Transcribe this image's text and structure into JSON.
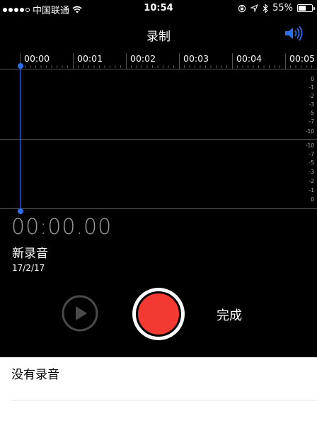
{
  "status_bar": {
    "carrier": "中国联通",
    "time": "10:54",
    "battery": "55%",
    "battery_level": 0.55,
    "icons": [
      "signal-dots-icon",
      "wifi-icon",
      "rotation-lock-icon",
      "location-icon",
      "bluetooth-icon",
      "battery-icon"
    ]
  },
  "nav": {
    "title": "录制",
    "speaker_icon": "speaker-icon"
  },
  "timeline": {
    "labels": [
      "00:00",
      "00:01",
      "00:02",
      "00:03",
      "00:04",
      "00:05"
    ]
  },
  "db_scale": {
    "upper": [
      "0",
      "-1",
      "-2",
      "-3",
      "-5",
      "-7",
      "-10"
    ],
    "lower": [
      "-10",
      "-7",
      "-5",
      "-3",
      "-2",
      "-1",
      "0"
    ]
  },
  "recording": {
    "elapsed": "00:00.00",
    "name": "新录音",
    "date": "17/2/17"
  },
  "controls": {
    "done_label": "完成",
    "play_icon": "play-icon",
    "record_icon": "record-icon"
  },
  "list": {
    "empty_text": "没有录音"
  },
  "colors": {
    "accent": "#2a6ee8",
    "record": "#f23a32",
    "background": "#000000"
  }
}
